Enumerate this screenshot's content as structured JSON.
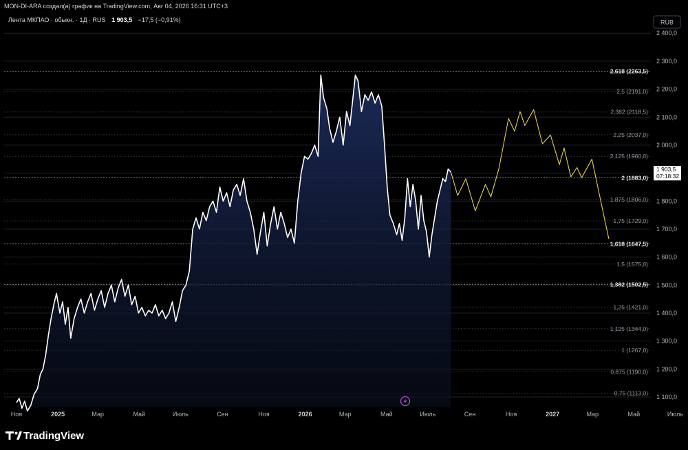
{
  "header": {
    "attribution": "MON-DI-ARA создал(а) график на TradingView.com, Авг 04, 2026 16:31 UTC+3",
    "symbol_line": "Лента МКПАО · обыкн. · 1Д · RUS",
    "last_price": "1 903,5",
    "change": "−17,5 (−0,91%)"
  },
  "currency_button": "RUB",
  "price_badge": {
    "price": "1 903,5",
    "countdown": "07:18:32"
  },
  "brand": "TradingView",
  "colors": {
    "background": "#000000",
    "price_line": "#ffffff",
    "area_fill_top": "#1b2a55",
    "projection": "#e6cf4f",
    "grid": "#2a2e39",
    "fib_key_line": "#9598a1",
    "event_icon": "#b14bd6"
  },
  "chart_data": {
    "type": "line",
    "title": "",
    "ylabel": "",
    "xlabel": "",
    "ylim": [
      1075,
      2440
    ],
    "y_ticks": [
      {
        "value": 1100,
        "label": "1 100,0"
      },
      {
        "value": 1200,
        "label": "1 200,0"
      },
      {
        "value": 1300,
        "label": "1 300,0"
      },
      {
        "value": 1400,
        "label": "1 400,0"
      },
      {
        "value": 1500,
        "label": "1 500,0"
      },
      {
        "value": 1600,
        "label": "1 600,0"
      },
      {
        "value": 1700,
        "label": "1 700,0"
      },
      {
        "value": 1800,
        "label": "1 800,0"
      },
      {
        "value": 1900,
        "label": "1 900,0"
      },
      {
        "value": 2000,
        "label": "2 000,0"
      },
      {
        "value": 2100,
        "label": "2 100,0"
      },
      {
        "value": 2200,
        "label": "2 200,0"
      },
      {
        "value": 2300,
        "label": "2 300,0"
      },
      {
        "value": 2400,
        "label": "2 400,0"
      }
    ],
    "x_ticks": [
      {
        "date": "2024-11-01",
        "label": "Ноя",
        "bold": false
      },
      {
        "date": "2025-01-01",
        "label": "2025",
        "bold": true
      },
      {
        "date": "2025-03-01",
        "label": "Мар",
        "bold": false
      },
      {
        "date": "2025-05-01",
        "label": "Май",
        "bold": false
      },
      {
        "date": "2025-07-01",
        "label": "Июль",
        "bold": false
      },
      {
        "date": "2025-09-01",
        "label": "Сен",
        "bold": false
      },
      {
        "date": "2025-11-01",
        "label": "Ноя",
        "bold": false
      },
      {
        "date": "2026-01-01",
        "label": "2026",
        "bold": true
      },
      {
        "date": "2026-03-01",
        "label": "Мар",
        "bold": false
      },
      {
        "date": "2026-05-01",
        "label": "Май",
        "bold": false
      },
      {
        "date": "2026-07-01",
        "label": "Июль",
        "bold": false
      },
      {
        "date": "2026-09-01",
        "label": "Сен",
        "bold": false
      },
      {
        "date": "2026-11-01",
        "label": "Ноя",
        "bold": false
      },
      {
        "date": "2027-01-01",
        "label": "2027",
        "bold": true
      },
      {
        "date": "2027-03-01",
        "label": "Мар",
        "bold": false
      },
      {
        "date": "2027-05-01",
        "label": "Май",
        "bold": false
      },
      {
        "date": "2027-07-01",
        "label": "Июль",
        "bold": false
      }
    ],
    "fib_levels": [
      {
        "label": "2,618 (2263,5)",
        "value": 2263.5,
        "key": true
      },
      {
        "label": "2,5 (2191,0)",
        "value": 2191.0,
        "key": false
      },
      {
        "label": "2,382 (2118,5)",
        "value": 2118.5,
        "key": false
      },
      {
        "label": "2,25 (2037,0)",
        "value": 2037.0,
        "key": false
      },
      {
        "label": "2,125 (1960,0)",
        "value": 1960.0,
        "key": false
      },
      {
        "label": "2 (1883,0)",
        "value": 1883.0,
        "key": true
      },
      {
        "label": "1,875 (1806,0)",
        "value": 1806.0,
        "key": false
      },
      {
        "label": "1,75 (1729,0)",
        "value": 1729.0,
        "key": false
      },
      {
        "label": "1,618 (1647,5)",
        "value": 1647.5,
        "key": true
      },
      {
        "label": "1,5 (1575,0)",
        "value": 1575.0,
        "key": false
      },
      {
        "label": "1,382 (1502,5)",
        "value": 1502.5,
        "key": true
      },
      {
        "label": "1,25 (1421,0)",
        "value": 1421.0,
        "key": false
      },
      {
        "label": "1,125 (1344,0)",
        "value": 1344.0,
        "key": false
      },
      {
        "label": "1 (1267,0)",
        "value": 1267.0,
        "key": false
      },
      {
        "label": "0,875 (1190,0)",
        "value": 1190.0,
        "key": false
      },
      {
        "label": "0,75 (1113,0)",
        "value": 1113.0,
        "key": false
      }
    ],
    "series": [
      {
        "points": [
          [
            "2024-11-01",
            1080
          ],
          [
            "2024-11-05",
            1095
          ],
          [
            "2024-11-09",
            1060
          ],
          [
            "2024-11-13",
            1085
          ],
          [
            "2024-11-17",
            1050
          ],
          [
            "2024-11-22",
            1070
          ],
          [
            "2024-11-27",
            1110
          ],
          [
            "2024-12-02",
            1130
          ],
          [
            "2024-12-06",
            1180
          ],
          [
            "2024-12-10",
            1200
          ],
          [
            "2024-12-14",
            1250
          ],
          [
            "2024-12-18",
            1320
          ],
          [
            "2024-12-22",
            1380
          ],
          [
            "2024-12-26",
            1430
          ],
          [
            "2024-12-30",
            1470
          ],
          [
            "2025-01-04",
            1400
          ],
          [
            "2025-01-08",
            1440
          ],
          [
            "2025-01-12",
            1360
          ],
          [
            "2025-01-16",
            1420
          ],
          [
            "2025-01-20",
            1310
          ],
          [
            "2025-01-25",
            1380
          ],
          [
            "2025-01-30",
            1420
          ],
          [
            "2025-02-04",
            1450
          ],
          [
            "2025-02-09",
            1400
          ],
          [
            "2025-02-14",
            1440
          ],
          [
            "2025-02-19",
            1470
          ],
          [
            "2025-02-24",
            1410
          ],
          [
            "2025-03-01",
            1450
          ],
          [
            "2025-03-06",
            1480
          ],
          [
            "2025-03-11",
            1420
          ],
          [
            "2025-03-16",
            1470
          ],
          [
            "2025-03-21",
            1500
          ],
          [
            "2025-03-26",
            1440
          ],
          [
            "2025-03-31",
            1490
          ],
          [
            "2025-04-05",
            1520
          ],
          [
            "2025-04-10",
            1460
          ],
          [
            "2025-04-15",
            1500
          ],
          [
            "2025-04-20",
            1430
          ],
          [
            "2025-04-25",
            1460
          ],
          [
            "2025-04-30",
            1400
          ],
          [
            "2025-05-05",
            1420
          ],
          [
            "2025-05-10",
            1390
          ],
          [
            "2025-05-15",
            1410
          ],
          [
            "2025-05-20",
            1400
          ],
          [
            "2025-05-25",
            1430
          ],
          [
            "2025-05-30",
            1390
          ],
          [
            "2025-06-04",
            1410
          ],
          [
            "2025-06-09",
            1380
          ],
          [
            "2025-06-14",
            1400
          ],
          [
            "2025-06-19",
            1440
          ],
          [
            "2025-06-24",
            1370
          ],
          [
            "2025-06-29",
            1420
          ],
          [
            "2025-07-04",
            1480
          ],
          [
            "2025-07-09",
            1500
          ],
          [
            "2025-07-14",
            1550
          ],
          [
            "2025-07-19",
            1700
          ],
          [
            "2025-07-24",
            1740
          ],
          [
            "2025-07-29",
            1700
          ],
          [
            "2025-08-03",
            1760
          ],
          [
            "2025-08-08",
            1730
          ],
          [
            "2025-08-13",
            1780
          ],
          [
            "2025-08-18",
            1800
          ],
          [
            "2025-08-23",
            1760
          ],
          [
            "2025-08-28",
            1850
          ],
          [
            "2025-09-02",
            1800
          ],
          [
            "2025-09-07",
            1830
          ],
          [
            "2025-09-12",
            1780
          ],
          [
            "2025-09-17",
            1840
          ],
          [
            "2025-09-22",
            1860
          ],
          [
            "2025-09-27",
            1820
          ],
          [
            "2025-10-02",
            1880
          ],
          [
            "2025-10-07",
            1800
          ],
          [
            "2025-10-12",
            1760
          ],
          [
            "2025-10-17",
            1700
          ],
          [
            "2025-10-22",
            1610
          ],
          [
            "2025-10-27",
            1690
          ],
          [
            "2025-11-01",
            1760
          ],
          [
            "2025-11-06",
            1640
          ],
          [
            "2025-11-11",
            1720
          ],
          [
            "2025-11-16",
            1780
          ],
          [
            "2025-11-21",
            1700
          ],
          [
            "2025-11-26",
            1760
          ],
          [
            "2025-12-01",
            1720
          ],
          [
            "2025-12-06",
            1670
          ],
          [
            "2025-12-11",
            1700
          ],
          [
            "2025-12-16",
            1650
          ],
          [
            "2025-12-21",
            1800
          ],
          [
            "2025-12-26",
            1900
          ],
          [
            "2025-12-31",
            1960
          ],
          [
            "2026-01-05",
            1950
          ],
          [
            "2026-01-10",
            1970
          ],
          [
            "2026-01-15",
            2000
          ],
          [
            "2026-01-20",
            1960
          ],
          [
            "2026-01-24",
            2250
          ],
          [
            "2026-01-28",
            2170
          ],
          [
            "2026-02-02",
            2130
          ],
          [
            "2026-02-06",
            2060
          ],
          [
            "2026-02-11",
            2010
          ],
          [
            "2026-02-16",
            2050
          ],
          [
            "2026-02-21",
            2100
          ],
          [
            "2026-02-26",
            2000
          ],
          [
            "2026-03-03",
            2120
          ],
          [
            "2026-03-08",
            2070
          ],
          [
            "2026-03-12",
            2160
          ],
          [
            "2026-03-16",
            2250
          ],
          [
            "2026-03-20",
            2230
          ],
          [
            "2026-03-25",
            2120
          ],
          [
            "2026-03-30",
            2180
          ],
          [
            "2026-04-04",
            2160
          ],
          [
            "2026-04-09",
            2190
          ],
          [
            "2026-04-14",
            2150
          ],
          [
            "2026-04-19",
            2180
          ],
          [
            "2026-04-24",
            2140
          ],
          [
            "2026-04-28",
            2000
          ],
          [
            "2026-05-02",
            1850
          ],
          [
            "2026-05-06",
            1750
          ],
          [
            "2026-05-11",
            1720
          ],
          [
            "2026-05-16",
            1680
          ],
          [
            "2026-05-20",
            1720
          ],
          [
            "2026-05-24",
            1660
          ],
          [
            "2026-05-28",
            1740
          ],
          [
            "2026-06-01",
            1880
          ],
          [
            "2026-06-05",
            1780
          ],
          [
            "2026-06-09",
            1860
          ],
          [
            "2026-06-13",
            1800
          ],
          [
            "2026-06-17",
            1700
          ],
          [
            "2026-06-21",
            1820
          ],
          [
            "2026-06-25",
            1730
          ],
          [
            "2026-06-29",
            1690
          ],
          [
            "2026-07-03",
            1600
          ],
          [
            "2026-07-07",
            1680
          ],
          [
            "2026-07-11",
            1740
          ],
          [
            "2026-07-15",
            1800
          ],
          [
            "2026-07-19",
            1840
          ],
          [
            "2026-07-23",
            1880
          ],
          [
            "2026-07-27",
            1870
          ],
          [
            "2026-07-31",
            1915
          ],
          [
            "2026-08-04",
            1903.5
          ]
        ]
      },
      {
        "points": [
          [
            "2026-08-04",
            1903.5
          ],
          [
            "2026-08-14",
            1820
          ],
          [
            "2026-08-26",
            1880
          ],
          [
            "2026-09-09",
            1765
          ],
          [
            "2026-09-24",
            1860
          ],
          [
            "2026-10-02",
            1815
          ],
          [
            "2026-10-14",
            1918
          ],
          [
            "2026-10-28",
            2095
          ],
          [
            "2026-11-06",
            2050
          ],
          [
            "2026-11-14",
            2120
          ],
          [
            "2026-11-21",
            2070
          ],
          [
            "2026-12-04",
            2127
          ],
          [
            "2026-12-17",
            2005
          ],
          [
            "2026-12-29",
            2036
          ],
          [
            "2027-01-11",
            1930
          ],
          [
            "2027-01-18",
            1990
          ],
          [
            "2027-01-28",
            1887
          ],
          [
            "2027-02-06",
            1920
          ],
          [
            "2027-02-13",
            1884
          ],
          [
            "2027-02-28",
            1950
          ],
          [
            "2027-03-25",
            1665
          ]
        ]
      }
    ]
  }
}
